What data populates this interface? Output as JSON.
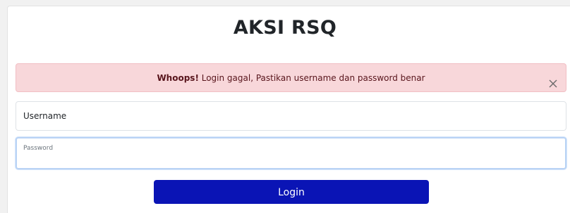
{
  "title": "AKSI RSQ",
  "alert": {
    "strong": "Whoops!",
    "message": " Login gagal, Pastikan username dan password benar",
    "close_icon": "close-icon"
  },
  "form": {
    "username_placeholder": "Username",
    "password_label": "Password",
    "login_label": "Login"
  },
  "colors": {
    "alert_bg": "#f8d7da",
    "alert_text": "#58151c",
    "button_bg": "#0a14b5",
    "focus_border": "#b9d3f5"
  }
}
